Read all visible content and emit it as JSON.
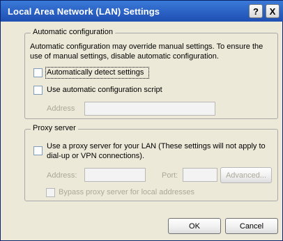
{
  "window": {
    "title": "Local Area Network (LAN) Settings",
    "help_label": "?",
    "close_label": "X"
  },
  "automatic_configuration": {
    "legend": "Automatic configuration",
    "description_line1": "Automatic configuration may override manual settings.  To ensure the",
    "description_line2": "use of manual settings, disable automatic configuration.",
    "detect_settings_label": "Automatically detect settings",
    "detect_settings_checked": false,
    "script_label": "Use automatic configuration script",
    "script_checked": false,
    "address_label": "Address",
    "address_value": ""
  },
  "proxy_server": {
    "legend": "Proxy server",
    "use_proxy_line1": "Use a proxy server for your LAN (These settings will not apply to",
    "use_proxy_line2": "dial-up or VPN connections).",
    "use_proxy_checked": false,
    "address_label": "Address:",
    "address_value": "",
    "port_label": "Port:",
    "port_value": "",
    "advanced_label": "Advanced...",
    "bypass_label": "Bypass proxy server for local addresses",
    "bypass_checked": false
  },
  "footer": {
    "ok_label": "OK",
    "cancel_label": "Cancel"
  }
}
